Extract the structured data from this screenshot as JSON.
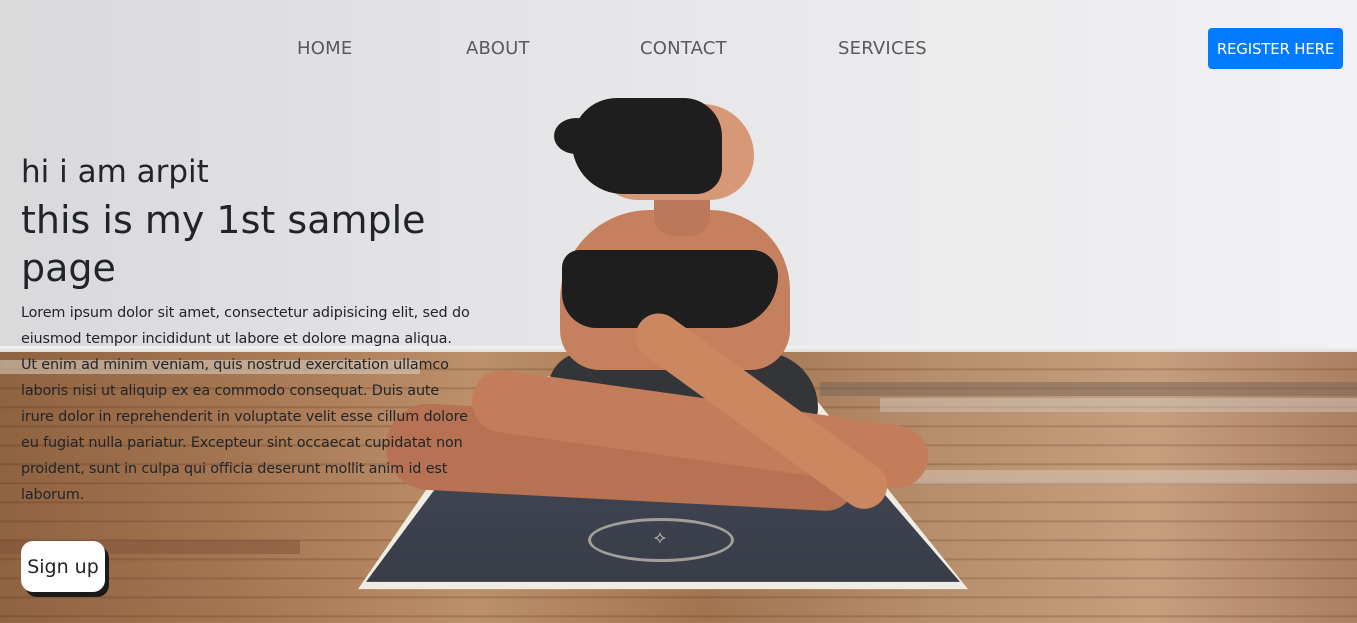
{
  "nav": {
    "links": [
      "HOME",
      "ABOUT",
      "CONTACT",
      "SERVICES"
    ],
    "register_label": "REGISTER HERE"
  },
  "hero": {
    "greeting": "hi i am arpit",
    "title": "this is my 1st sample page",
    "body": "Lorem ipsum dolor sit amet, consectetur adipisicing elit, sed do eiusmod tempor incididunt ut labore et dolore magna aliqua. Ut enim ad minim veniam, quis nostrud exercitation ullamco laboris nisi ut aliquip ex ea commodo consequat. Duis aute irure dolor in reprehenderit in voluptate velit esse cillum dolore eu fugiat nulla pariatur. Excepteur sint occaecat cupidatat non proident, sunt in culpa qui officia deserunt mollit anim id est laborum.",
    "signup_label": "Sign up"
  },
  "colors": {
    "accent": "#007bff",
    "text": "#212529",
    "nav_text": "#5a5a5c"
  }
}
